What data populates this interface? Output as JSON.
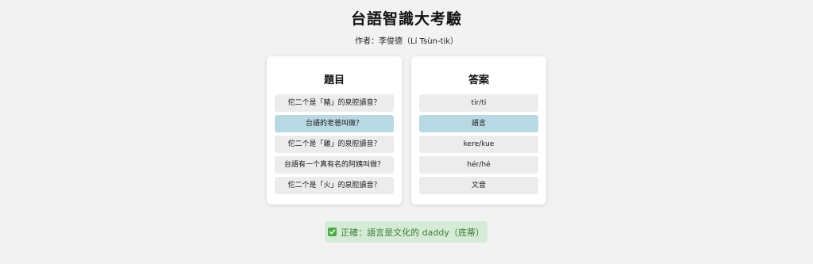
{
  "title": "台語智識大考驗",
  "author": "作者：李俊德（Lí Tsùn-tik）",
  "questions": {
    "heading": "題目",
    "items": [
      "佗二个是「豬」的泉腔讀音？",
      "台語的老爸叫做？",
      "佗二个是「雞」的泉腔讀音？",
      "台語有一个真有名的阿姨叫做？",
      "佗二个是「火」的泉腔讀音？"
    ],
    "selected_index": 1
  },
  "answers": {
    "heading": "答案",
    "items": [
      "tir/ti",
      "語言",
      "kere/kue",
      "hér/hé",
      "文音"
    ],
    "selected_index": 1
  },
  "result": {
    "icon": "check-icon",
    "text": "正確：語言是文化的 daddy（底蒂）"
  },
  "colors": {
    "background": "#f2f2f2",
    "selected": "#b8d8e4",
    "item": "#ececec",
    "success_bg": "#d6ebd5",
    "success_text": "#3d7a3a",
    "check": "#4caa45"
  }
}
